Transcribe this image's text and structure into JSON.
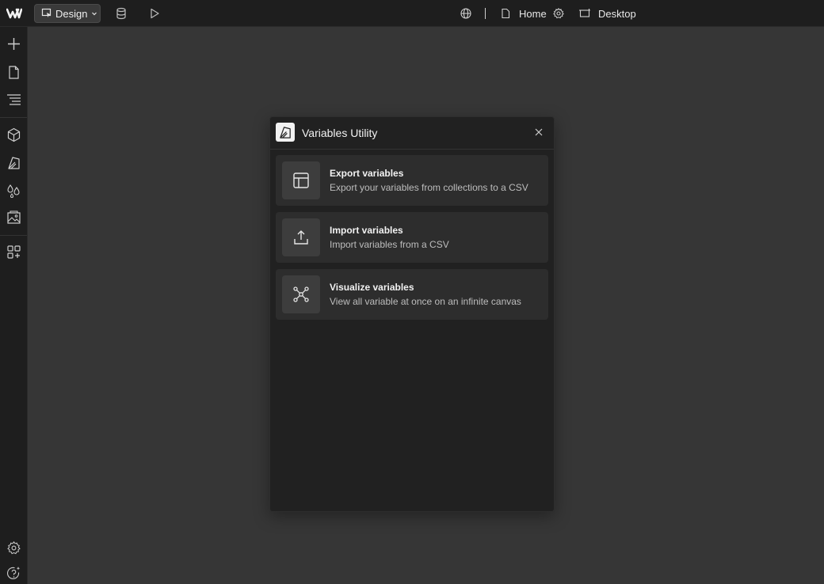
{
  "topbar": {
    "mode_label": "Design",
    "page_label": "Home",
    "breakpoint_label": "Desktop"
  },
  "dialog": {
    "title": "Variables Utility",
    "cards": [
      {
        "title": "Export variables",
        "description": "Export your variables from collections to a CSV",
        "icon": "table-icon"
      },
      {
        "title": "Import variables",
        "description": "Import variables from a CSV",
        "icon": "upload-icon"
      },
      {
        "title": "Visualize variables",
        "description": "View all variable at once on an infinite canvas",
        "icon": "graph-icon"
      }
    ]
  },
  "colors": {
    "canvas": "#363636",
    "chrome": "#1e1e1e",
    "dialog": "#212121",
    "card": "#2d2d2d"
  }
}
